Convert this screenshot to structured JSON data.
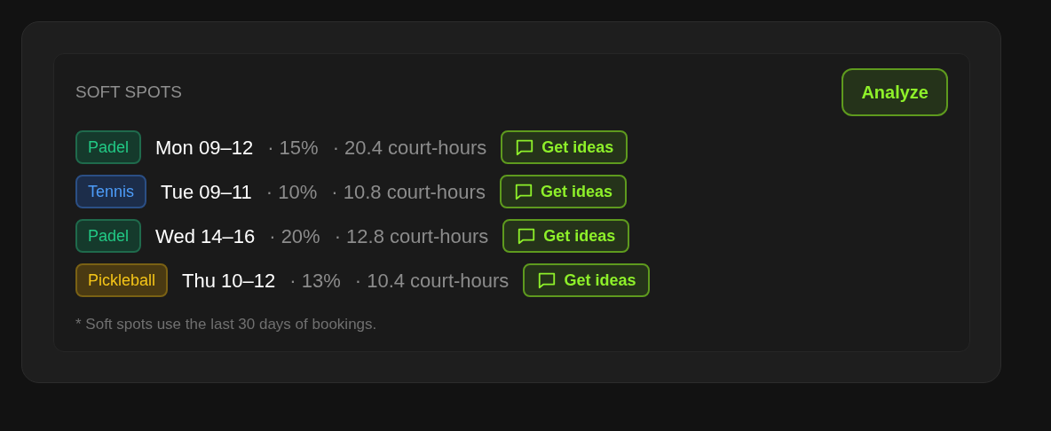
{
  "title": "SOFT SPOTS",
  "analyze_button": "Analyze",
  "spots": [
    {
      "sport": "Padel",
      "kind": "green",
      "slot": "Mon 09–12",
      "share": "· 15%",
      "hours": "· 20.4 court-hours",
      "action": "Get ideas"
    },
    {
      "sport": "Tennis",
      "kind": "blue",
      "slot": "Tue 09–11",
      "share": "· 10%",
      "hours": "· 10.8 court-hours",
      "action": "Get ideas"
    },
    {
      "sport": "Padel",
      "kind": "green",
      "slot": "Wed 14–16",
      "share": "· 20%",
      "hours": "· 12.8 court-hours",
      "action": "Get ideas"
    },
    {
      "sport": "Pickleball",
      "kind": "yellow",
      "slot": "Thu 10–12",
      "share": "· 13%",
      "hours": "· 10.4 court-hours",
      "action": "Get ideas"
    }
  ],
  "footnote": "* Soft spots use the last 30 days of bookings."
}
